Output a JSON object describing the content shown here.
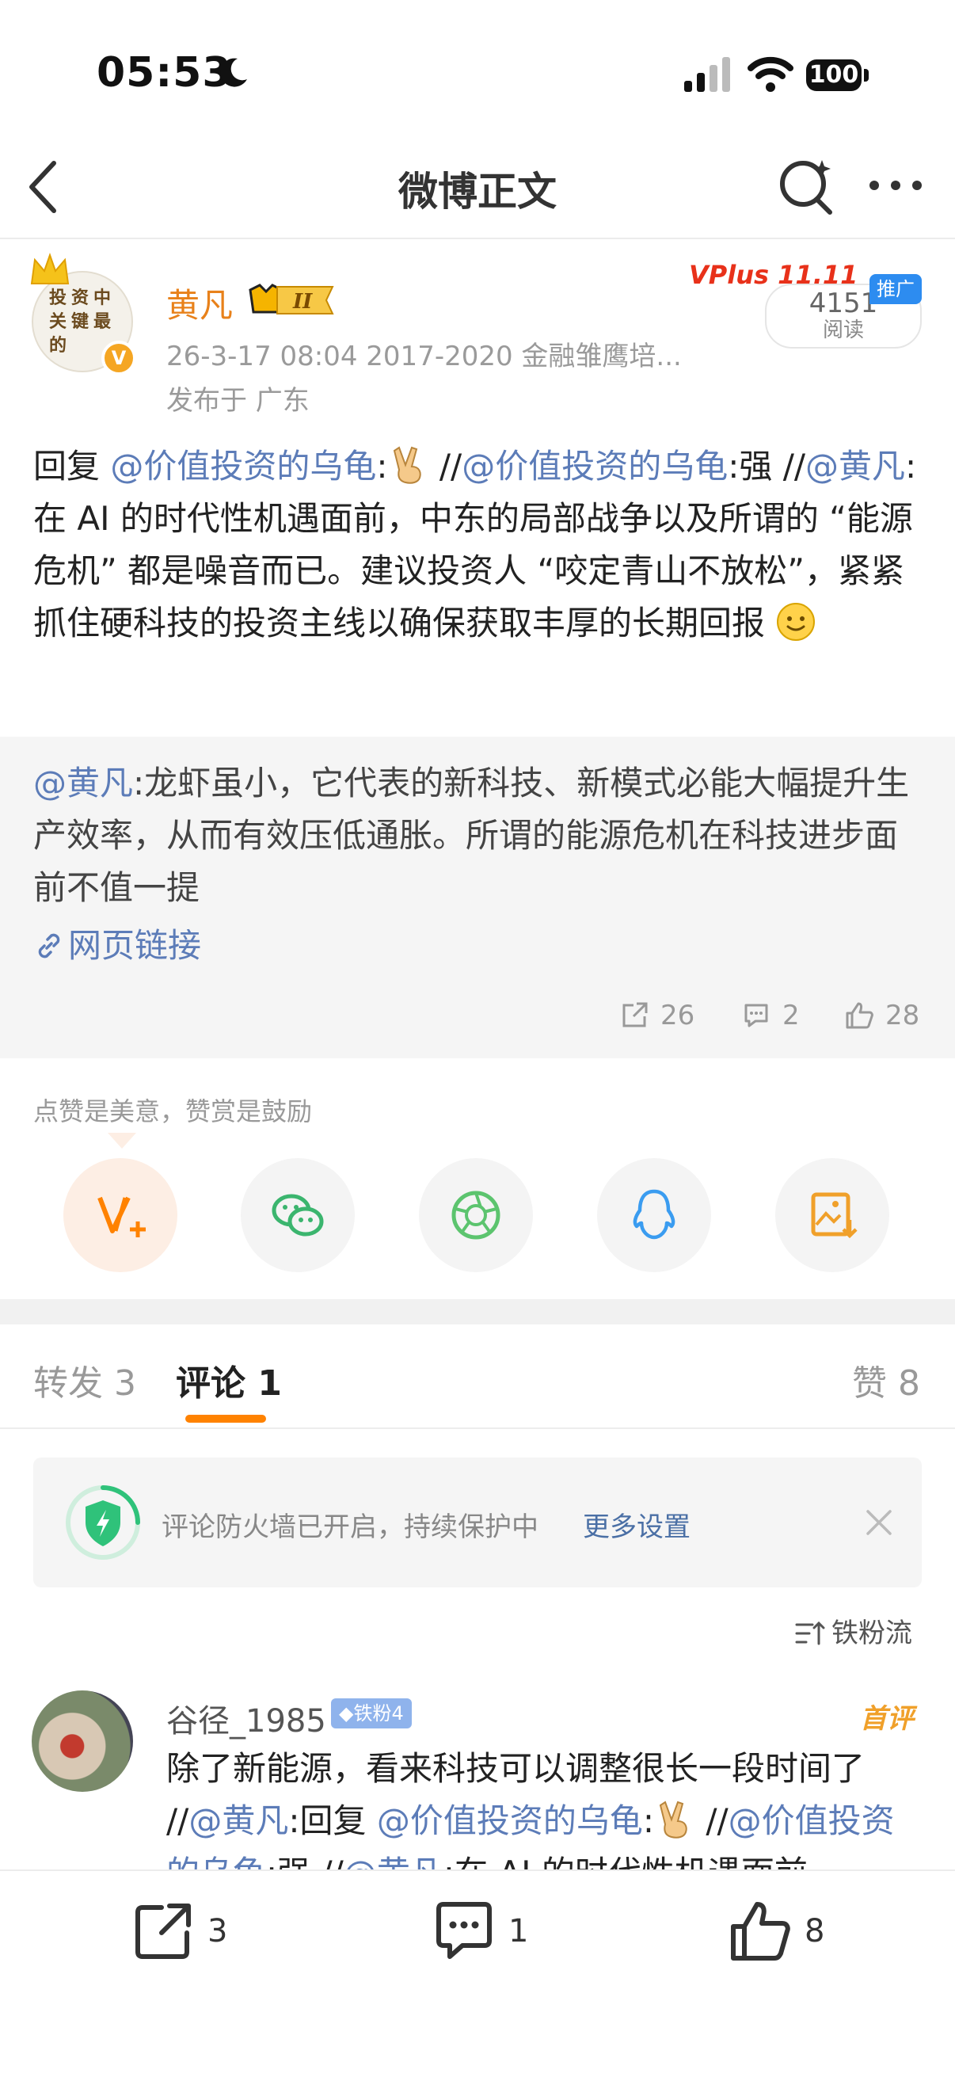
{
  "status_bar": {
    "time": "05:53",
    "battery": "100"
  },
  "nav": {
    "title": "微博正文"
  },
  "author": {
    "name": "黄凡",
    "level_badge": "II",
    "avatar_text": "投资中关键最的",
    "verified_mark": "V",
    "meta_line1": "26-3-17 08:04  2017-2020 金融雏鹰培...",
    "meta_line2": "发布于 广东"
  },
  "ad": {
    "banner_text": "VPlus 11.11",
    "read_count": "4151",
    "read_label": "阅读",
    "promo_tag": "推广"
  },
  "post": {
    "reply_prefix": "回复",
    "mention1": "@价值投资的乌龟",
    "sep1": ":",
    "sep2": " //",
    "mention2": "@价值投资的乌龟",
    "text2": ":强 //",
    "mention3": "@黄凡",
    "body": ":在 AI 的时代性机遇面前，中东的局部战争以及所谓的 “能源危机” 都是噪音而已。建议投资人 “咬定青山不放松”，紧紧抓住硬科技的投资主线以确保获取丰厚的长期回报"
  },
  "quote": {
    "mention": "@黄凡",
    "body": ":龙虾虽小，它代表的新科技、新模式必能大幅提升生产效率，从而有效压低通胀。所谓的能源危机在科技进步面前不值一提",
    "link_label": "网页链接",
    "reposts": "26",
    "comments": "2",
    "likes": "28"
  },
  "reward": {
    "hint": "点赞是美意，赞赏是鼓励"
  },
  "tabs": {
    "repost": "转发 3",
    "comment": "评论 1",
    "like": "赞 8"
  },
  "firewall": {
    "text": "评论防火墙已开启，持续保护中",
    "more": "更多设置"
  },
  "sort": {
    "label": "铁粉流"
  },
  "comment": {
    "user": "谷径_1985",
    "fan_badge": "◆铁粉4",
    "first_tag": "首评",
    "text_plain1": "除了新能源，看来科技可以调整很长一段时间了 //",
    "mention1": "@黄凡",
    "text_plain2": ":回复 ",
    "mention2": "@价值投资的乌龟",
    "sep": ":",
    "sep2": " //",
    "mention3": "@价值投资的乌龟",
    "text_plain3": ":强 //",
    "mention4": "@黄凡",
    "text_plain4": ":在 AI 的时代性机遇面前"
  },
  "bottom_bar": {
    "repost_count": "3",
    "comment_count": "1",
    "like_count": "8"
  },
  "colors": {
    "accent_orange": "#ff8200",
    "mention_blue": "#5c7cb8",
    "name_orange": "#e8811a"
  }
}
